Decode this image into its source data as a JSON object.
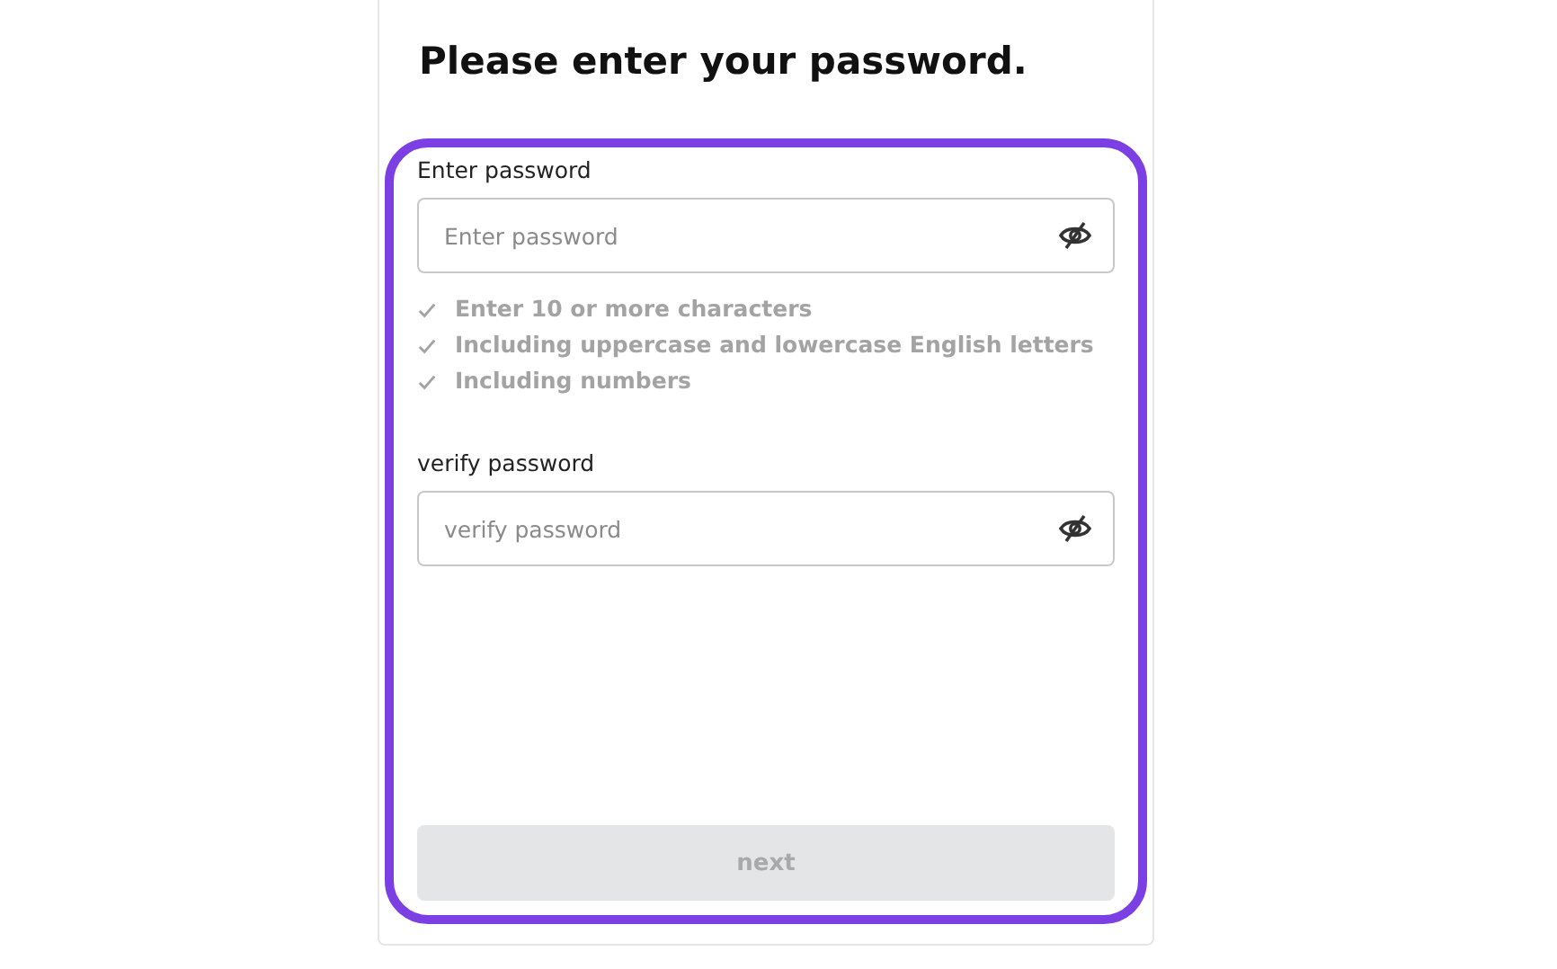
{
  "title": "Please enter your password.",
  "highlighted": true,
  "password": {
    "label": "Enter password",
    "placeholder": "Enter password",
    "masked": true
  },
  "requirements": [
    {
      "text": "Enter 10 or more characters",
      "met": false
    },
    {
      "text": "Including uppercase and lowercase English letters",
      "met": false
    },
    {
      "text": "Including numbers",
      "met": false
    }
  ],
  "verify": {
    "label": "verify password",
    "placeholder": "verify password",
    "masked": true
  },
  "next_button": {
    "label": "next",
    "disabled": true
  }
}
